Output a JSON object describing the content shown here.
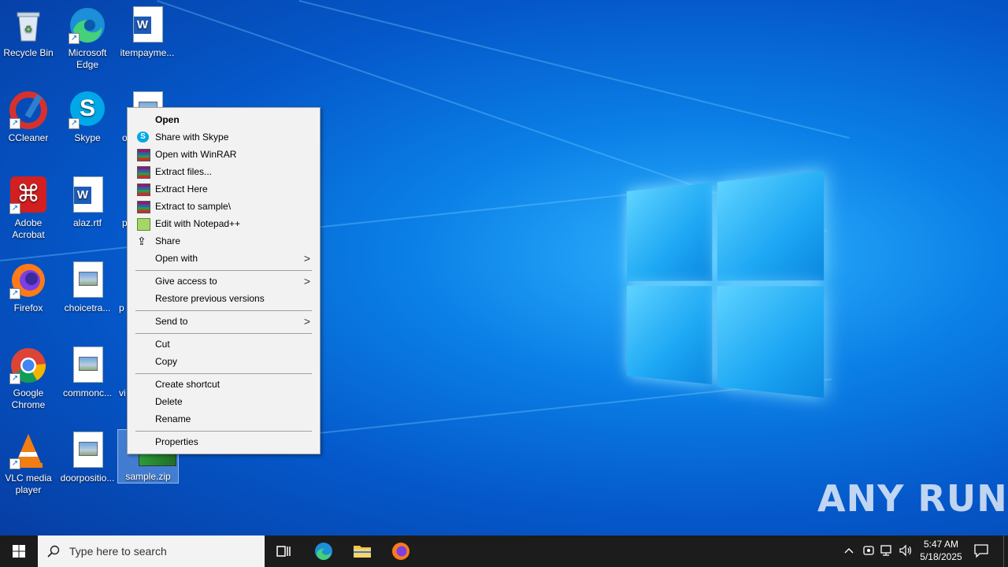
{
  "desktop": {
    "icons": [
      {
        "label": "Recycle Bin"
      },
      {
        "label": "Microsoft Edge"
      },
      {
        "label": "itempayme..."
      },
      {
        "label": "CCleaner"
      },
      {
        "label": "Skype"
      },
      {
        "label": "o"
      },
      {
        "label": "Adobe Acrobat"
      },
      {
        "label": "alaz.rtf"
      },
      {
        "label": "p"
      },
      {
        "label": "Firefox"
      },
      {
        "label": "choicetra..."
      },
      {
        "label": "p"
      },
      {
        "label": "Google Chrome"
      },
      {
        "label": "commonc..."
      },
      {
        "label": "vi"
      },
      {
        "label": "VLC media player"
      },
      {
        "label": "doorpositio..."
      },
      {
        "label": "sample.zip"
      }
    ]
  },
  "context_menu": {
    "items": [
      {
        "label": "Open",
        "icon": "none"
      },
      {
        "label": "Share with Skype",
        "icon": "skype-icon"
      },
      {
        "label": "Open with WinRAR",
        "icon": "winrar-icon"
      },
      {
        "label": "Extract files...",
        "icon": "winrar-icon"
      },
      {
        "label": "Extract Here",
        "icon": "winrar-icon"
      },
      {
        "label": "Extract to sample\\",
        "icon": "winrar-icon"
      },
      {
        "label": "Edit with Notepad++",
        "icon": "notepadpp-icon"
      },
      {
        "label": "Share",
        "icon": "share-icon"
      },
      {
        "label": "Open with",
        "icon": "none"
      },
      {
        "label": "Give access to",
        "icon": "none"
      },
      {
        "label": "Restore previous versions",
        "icon": "none"
      },
      {
        "label": "Send to",
        "icon": "none"
      },
      {
        "label": "Cut",
        "icon": "none"
      },
      {
        "label": "Copy",
        "icon": "none"
      },
      {
        "label": "Create shortcut",
        "icon": "none"
      },
      {
        "label": "Delete",
        "icon": "none"
      },
      {
        "label": "Rename",
        "icon": "none"
      },
      {
        "label": "Properties",
        "icon": "none"
      }
    ],
    "submenu_arrow": ">"
  },
  "taskbar": {
    "search_placeholder": "Type here to search",
    "time": "5:47 AM",
    "date": "5/18/2025"
  },
  "watermark": "ANY RUN",
  "colors": {
    "taskbar": "#1c1c1c",
    "menu_bg": "#f2f2f2",
    "accent": "#0a7fe6"
  }
}
